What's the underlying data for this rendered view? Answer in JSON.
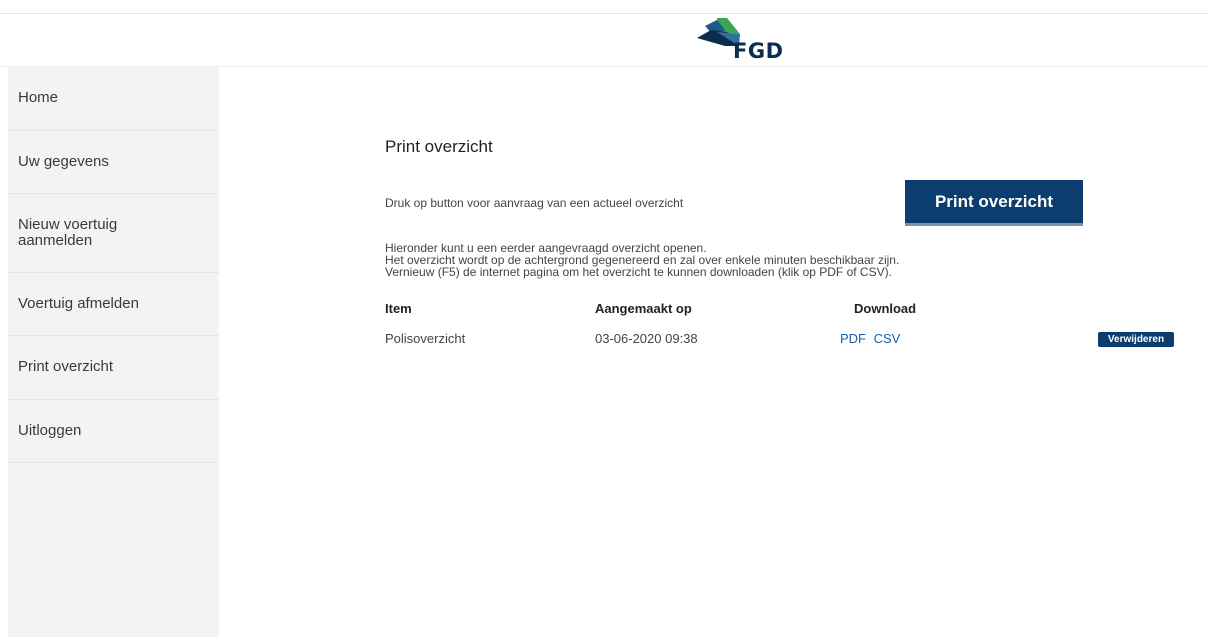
{
  "brand": {
    "logo_text": "FGD",
    "colors": {
      "green": "#3aa655",
      "blue": "#0b3d6e",
      "navy": "#0d2d4d"
    }
  },
  "sidebar": {
    "items": [
      {
        "label": "Home"
      },
      {
        "label": "Uw gegevens"
      },
      {
        "label": "Nieuw voertuig aanmelden"
      },
      {
        "label": "Voertuig afmelden"
      },
      {
        "label": "Print overzicht"
      },
      {
        "label": "Uitloggen"
      }
    ]
  },
  "main": {
    "title": "Print overzicht",
    "press_text": "Druk op button voor aanvraag van een actueel overzicht",
    "print_button_label": "Print overzicht",
    "info_lines": [
      "Hieronder kunt u een eerder aangevraagd overzicht openen.",
      "Het overzicht wordt op de achtergrond gegenereerd en zal over enkele minuten beschikbaar zijn.",
      "Vernieuw (F5) de internet pagina om het overzicht te kunnen downloaden (klik op PDF of CSV)."
    ],
    "table": {
      "headers": [
        "Item",
        "Aangemaakt op",
        "Download"
      ],
      "rows": [
        {
          "item": "Polisoverzicht",
          "created": "03-06-2020 09:38",
          "pdf": "PDF",
          "csv": "CSV",
          "delete_label": "Verwijderen"
        }
      ]
    }
  }
}
